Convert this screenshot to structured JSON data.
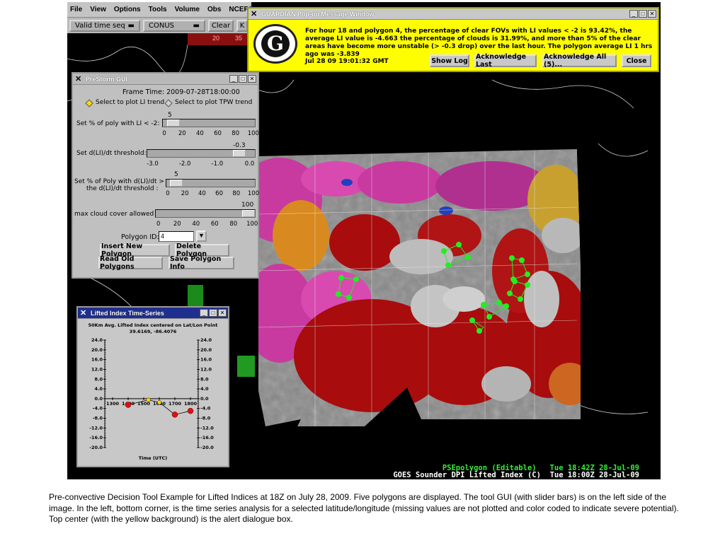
{
  "menu": {
    "items": [
      "File",
      "View",
      "Options",
      "Tools",
      "Volume",
      "Obs",
      "NCEP/Hydro"
    ]
  },
  "toolbar": {
    "time_select": "Valid time seq",
    "scale_select": "CONUS",
    "clear_label": "Clear",
    "extra": "K"
  },
  "colorbar": {
    "labels": [
      "20",
      "35"
    ]
  },
  "guardian": {
    "title": "GUARDIAN Pop-up Message Window",
    "message": "For hour 18 and polygon 4, the percentage of clear FOVs with LI values < -2 is 93.42%, the average LI value is -4.663 the percentage of clouds is 31.99%, and  more than 5% of the clear areas have become more unstable (> -0.3 drop) over the last  hour. The polygon average LI 1 hrs ago was -3.839",
    "timestamp": "Jul 28 09 19:01:32 GMT",
    "buttons": {
      "show_log": "Show Log",
      "ack_last": "Acknowledge Last",
      "ack_all": "Acknowledge All (5)...",
      "close": "Close"
    }
  },
  "prestorm": {
    "title": "PreStorm GUI",
    "frame_time": "Frame Time: 2009-07-28T18:00:00",
    "radio_li": "Select to plot LI trend",
    "radio_tpw": "Select to plot TPW trend",
    "slider1": {
      "label": "Set % of poly with LI < -2:",
      "value": "5",
      "fraction": 0.05,
      "ticks": [
        "0",
        "20",
        "40",
        "60",
        "80",
        "100"
      ]
    },
    "slider2": {
      "label": "Set d(LI)/dt threshold:",
      "value": "-0.3",
      "fraction": 0.9,
      "ticks": [
        "-3.0",
        "-2.0",
        "-1.0",
        "0.0"
      ]
    },
    "slider3": {
      "label_line1": "Set % of Poly with d(LI)/dt >",
      "label_line2": "the d(LI)/dt threshold :",
      "value": "5",
      "fraction": 0.05,
      "ticks": [
        "0",
        "20",
        "40",
        "60",
        "80",
        "100"
      ]
    },
    "slider4": {
      "label": "max cloud cover allowed  :",
      "value": "100",
      "fraction": 1.0,
      "ticks": [
        "0",
        "20",
        "40",
        "60",
        "80",
        "100"
      ]
    },
    "polygon_label": "Polygon ID:",
    "polygon_value": "4",
    "buttons": {
      "insert": "Insert New Polygon",
      "delete": "Delete Polygon",
      "read": "Read Old Polygons",
      "save": "Save Polygon Info"
    }
  },
  "li_window": {
    "title": "Lifted Index Time-Series",
    "subtitle1": "50Km Avg. Lifted Index centered on Lat/Lon Point",
    "subtitle2": "39.6169, -86.4076",
    "xlabel": "Time (UTC)",
    "y_ticks": [
      "24.0",
      "20.0",
      "16.0",
      "12.0",
      "8.0",
      "4.0",
      "0.0",
      "-4.0",
      "-8.0",
      "-12.0",
      "-16.0",
      "-20.0"
    ],
    "x_ticks": [
      "1300",
      "1400",
      "1500",
      "1600",
      "1700",
      "1800"
    ]
  },
  "chart_data": {
    "type": "line",
    "title": "50Km Avg. Lifted Index centered on Lat/Lon Point",
    "subtitle": "39.6169, -86.4076",
    "xlabel": "Time (UTC)",
    "ylabel": "",
    "ylim": [
      -20,
      24
    ],
    "x_ticks": [
      1300,
      1400,
      1500,
      1600,
      1700,
      1800
    ],
    "series": [
      {
        "points": [
          {
            "x": 1400,
            "y": -2.5,
            "color": "#e01010"
          },
          {
            "x": 1530,
            "y": -0.5,
            "color": "#f0e000"
          },
          {
            "x": 1600,
            "y": -1.5,
            "color": "#f0e000"
          },
          {
            "x": 1700,
            "y": -6.5,
            "color": "#e01010"
          },
          {
            "x": 1800,
            "y": -5.0,
            "color": "#e01010"
          }
        ]
      }
    ]
  },
  "status": {
    "line1": "PSEpolygon (Editable)   Tue 18:42Z 28-Jul-09",
    "line2": "GOES Sounder DPI Lifted Index (C)  Tue 18:00Z 28-Jul-09"
  },
  "caption": "Pre-convective Decision Tool Example for  Lifted Indices at 18Z  on July 28, 2009.  Five polygons are displayed.  The tool GUI (with slider bars) is on the  left side  of the image.  In the left, bottom corner, is the time series analysis for a selected latitude/longitude (missing values are not plotted and color coded to indicate severe potential).  Top center (with the yellow background) is the alert dialogue box.",
  "colors": {
    "unstable_red": "#a80c0c",
    "pink": "#d43aa8",
    "orange": "#d88a20",
    "cloud_gray": "#8c8c8c",
    "polygon_green": "#22ee22",
    "alert_yellow": "#fefe00",
    "status_green": "#33ee33"
  }
}
